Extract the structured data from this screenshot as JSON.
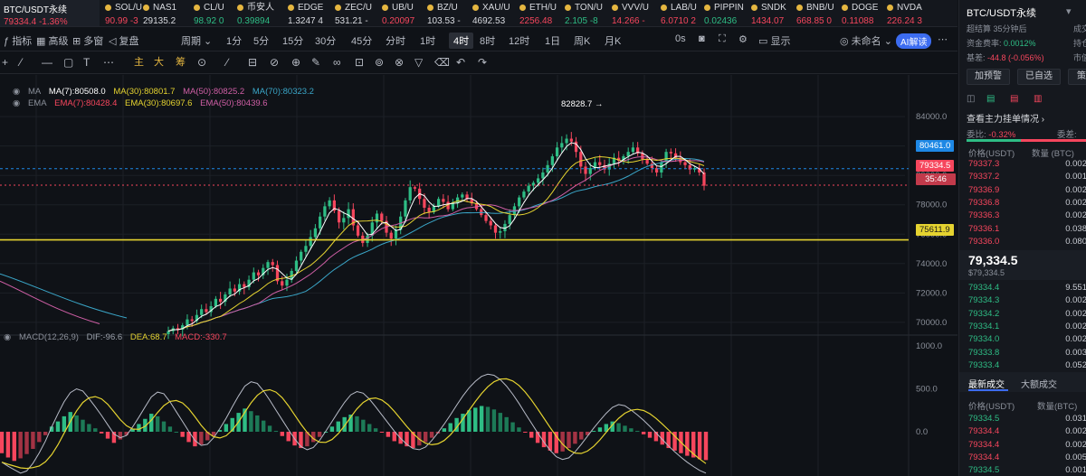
{
  "ticker": {
    "active": {
      "name": "BTC/USDT永续",
      "price": "79334.4",
      "change": "-1.36%"
    },
    "items": [
      {
        "name": "SOL/U",
        "price": "90.99",
        "change": "-3",
        "dir": "dn"
      },
      {
        "name": "NAS1",
        "price": "29135.2",
        "change": "",
        "dir": "flat"
      },
      {
        "name": "CL/U",
        "price": "98.92",
        "change": "0",
        "dir": "up"
      },
      {
        "name": "币安人",
        "price": "0.39894",
        "change": "",
        "dir": "up"
      },
      {
        "name": "EDGE",
        "price": "1.3247",
        "change": "4",
        "dir": "flat"
      },
      {
        "name": "ZEC/U",
        "price": "531.21",
        "change": "-",
        "dir": "flat"
      },
      {
        "name": "UB/U",
        "price": "0.20097",
        "change": "",
        "dir": "dn"
      },
      {
        "name": "BZ/U",
        "price": "103.53",
        "change": "-",
        "dir": "flat"
      },
      {
        "name": "XAU/U",
        "price": "4692.53",
        "change": "",
        "dir": "flat"
      },
      {
        "name": "ETH/U",
        "price": "2256.48",
        "change": "",
        "dir": "dn"
      },
      {
        "name": "TON/U",
        "price": "2.105",
        "change": "-8",
        "dir": "up"
      },
      {
        "name": "VVV/U",
        "price": "14.266",
        "change": "-",
        "dir": "dn"
      },
      {
        "name": "LAB/U",
        "price": "6.0710",
        "change": "2",
        "dir": "dn"
      },
      {
        "name": "PIPPIN",
        "price": "0.02436",
        "change": "",
        "dir": "up"
      },
      {
        "name": "SNDK",
        "price": "1434.07",
        "change": "",
        "dir": "dn"
      },
      {
        "name": "BNB/U",
        "price": "668.85",
        "change": "0",
        "dir": "dn"
      },
      {
        "name": "DOGE",
        "price": "0.11088",
        "change": "",
        "dir": "dn"
      },
      {
        "name": "NVDA",
        "price": "226.24",
        "change": "3",
        "dir": "dn"
      }
    ]
  },
  "intervals": {
    "indicator": "指标",
    "advanced": "高级",
    "multi": "多窗",
    "replay": "复盘",
    "period": "周期",
    "list": [
      "1分",
      "5分",
      "15分",
      "30分",
      "45分",
      "分时",
      "1时",
      "4时",
      "8时",
      "12时",
      "1日",
      "周K",
      "月K"
    ],
    "active_index": 7,
    "zero_s": "0s",
    "display": "显示",
    "unnamed": "未命名",
    "ai": "AI解读"
  },
  "draw": {
    "main": "主",
    "big": "大",
    "chip": "筹"
  },
  "legend": {
    "ma_label": "MA",
    "ma7": "MA(7):80508.0",
    "ma30": "MA(30):80801.7",
    "ma50": "MA(50):80825.2",
    "ma70": "MA(70):80323.2",
    "ema_label": "EMA",
    "ema7": "EMA(7):80428.4",
    "ema30": "EMA(30):80697.6",
    "ema50": "EMA(50):80439.6",
    "macd": "MACD(12,26,9)",
    "dif": "DIF:-96.6",
    "dea": "DEA:68.7",
    "macdv": "MACD:-330.7"
  },
  "colors": {
    "up": "#2ebd85",
    "down": "#f6465d",
    "yellow": "#e5d330",
    "blue": "#1e88e5",
    "pink": "#d05fa6",
    "teal": "#3aa6c8"
  },
  "chart_data": {
    "type": "candlestick",
    "price_axis": [
      "84000.0",
      "82000.0",
      "80000.0",
      "78000.0",
      "76000.0",
      "74000.0",
      "72000.0",
      "70000.0"
    ],
    "macd_axis": [
      "1000.0",
      "500.0",
      "0.0"
    ],
    "ylim": [
      69500,
      84500
    ],
    "high_annotation": "82828.7 →",
    "tags": {
      "ma_line": "80461.0",
      "last": "79334.5",
      "countdown": "35:46",
      "support": "75611.9"
    },
    "support_level": 75611.9,
    "last_price": 79334.5,
    "ma_line_level": 80461.0,
    "close": [
      69400,
      69600,
      69500,
      69800,
      70200,
      70100,
      70500,
      70900,
      70700,
      71100,
      71600,
      71400,
      71900,
      72300,
      72100,
      72600,
      72400,
      72900,
      73400,
      73200,
      73700,
      74100,
      73900,
      72800,
      72500,
      72900,
      73500,
      74200,
      74800,
      75200,
      75800,
      76400,
      77200,
      77900,
      78300,
      77600,
      76800,
      77100,
      77700,
      76600,
      75900,
      75400,
      75900,
      76800,
      77400,
      76900,
      76100,
      75700,
      76300,
      77200,
      78300,
      79200,
      79100,
      78400,
      77800,
      77500,
      77900,
      78400,
      78200,
      77700,
      78100,
      78500,
      78700,
      78400,
      78100,
      77700,
      77300,
      76900,
      76600,
      76100,
      76200,
      76700,
      77300,
      77900,
      78500,
      78900,
      79300,
      79500,
      79800,
      80200,
      80700,
      81300,
      81900,
      82200,
      82500,
      82300,
      81600,
      80600,
      80100,
      80500,
      80900,
      80700,
      80400,
      80800,
      81200,
      81000,
      81300,
      81600,
      81900,
      81500,
      81100,
      80800,
      80500,
      80200,
      80900,
      81600,
      81500,
      81200,
      80900,
      80700,
      80400,
      80500,
      80200,
      79300
    ],
    "macd_hist": [
      -250,
      -300,
      -340,
      -310,
      -260,
      -200,
      -120,
      -40,
      60,
      120,
      180,
      230,
      190,
      140,
      90,
      40,
      -20,
      -80,
      -130,
      -90,
      -40,
      30,
      90,
      150,
      210,
      180,
      120,
      60,
      0,
      -60,
      -120,
      -170,
      -150,
      -100,
      -50,
      20,
      90,
      160,
      220,
      270,
      240,
      190,
      130,
      70,
      10,
      -50,
      -110,
      -160,
      -190,
      -170,
      -120,
      -60,
      0,
      60,
      120,
      170,
      200,
      180,
      140,
      90,
      40,
      -10,
      -60,
      -110,
      -140,
      -170,
      -190,
      -160,
      -120,
      -70,
      -20,
      40,
      100,
      160,
      210,
      250,
      280,
      300,
      290,
      260,
      220,
      170,
      110,
      50,
      -10,
      -70,
      -130,
      -180,
      -220,
      -250,
      -230,
      -190,
      -140,
      -90,
      -40,
      10,
      50,
      90,
      120,
      100,
      70,
      40,
      10,
      -30,
      -70,
      -110,
      -150,
      -190,
      -220,
      -250,
      -280,
      -300,
      -320,
      -330
    ]
  },
  "panel": {
    "title": "BTC/USDT永续",
    "cycle_label": "超结算",
    "cycle_value": "35分钟后",
    "fund_label": "资金费率:",
    "fund_value": "0.0012%",
    "base_label": "基差:",
    "base_value": "-44.8 (-0.056%)",
    "right_a": "成交",
    "right_b": "持仓",
    "right_c": "市值",
    "btn_alert": "加预警",
    "btn_fav": "已自选",
    "btn_strategy": "策略",
    "view_orders": "查看主力挂单情况",
    "ratio_label": "委比:",
    "ratio_value": "-0.32%",
    "diff_label": "委差:",
    "col_price": "价格(USDT)",
    "col_qty": "数量 (BTC)",
    "asks": [
      {
        "p": "79337.3",
        "q": "0.002"
      },
      {
        "p": "79337.2",
        "q": "0.001"
      },
      {
        "p": "79336.9",
        "q": "0.002"
      },
      {
        "p": "79336.8",
        "q": "0.002"
      },
      {
        "p": "79336.3",
        "q": "0.002"
      },
      {
        "p": "79336.1",
        "q": "0.038"
      },
      {
        "p": "79336.0",
        "q": "0.080"
      }
    ],
    "last_big": "79,334.5",
    "last_small": "$79,334.5",
    "bids": [
      {
        "p": "79334.4",
        "q": "9.551"
      },
      {
        "p": "79334.3",
        "q": "0.002"
      },
      {
        "p": "79334.2",
        "q": "0.002"
      },
      {
        "p": "79334.1",
        "q": "0.002"
      },
      {
        "p": "79334.0",
        "q": "0.002"
      },
      {
        "p": "79333.8",
        "q": "0.003"
      },
      {
        "p": "79333.4",
        "q": "0.052"
      }
    ],
    "tab_latest": "最新成交",
    "tab_big": "大额成交",
    "trades_col_price": "价格(USDT)",
    "trades_col_qty": "数量(BTC)",
    "trades": [
      {
        "p": "79334.5",
        "q": "0.031",
        "dir": "bid"
      },
      {
        "p": "79334.4",
        "q": "0.002",
        "dir": "ask"
      },
      {
        "p": "79334.4",
        "q": "0.002",
        "dir": "ask"
      },
      {
        "p": "79334.4",
        "q": "0.005",
        "dir": "ask"
      },
      {
        "p": "79334.5",
        "q": "0.001",
        "dir": "bid"
      }
    ]
  }
}
